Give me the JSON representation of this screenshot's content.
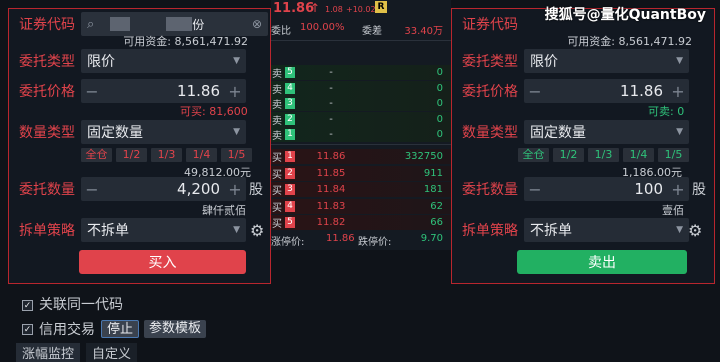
{
  "watermark": "搜狐号@量化QuantBoy",
  "buy_panel": {
    "code_label": "证券代码",
    "code_value": "",
    "name_value": "份",
    "available_funds": "可用资金:  8,561,471.92",
    "order_type_label": "委托类型",
    "order_type_value": "限价",
    "price_label": "委托价格",
    "price_value": "11.86",
    "can_buy": "可买:  81,600",
    "qty_type_label": "数量类型",
    "qty_type_value": "固定数量",
    "fractions": [
      "全仓",
      "1/2",
      "1/3",
      "1/4",
      "1/5"
    ],
    "amount": "49,812.00元",
    "qty_label": "委托数量",
    "qty_value": "4,200",
    "qty_unit": "股",
    "qty_chinese": "肆仟贰佰",
    "split_label": "拆单策略",
    "split_value": "不拆单",
    "submit_label": "买入"
  },
  "sell_panel": {
    "code_label": "证券代码",
    "available_funds": "可用资金:  8,561,471.92",
    "order_type_label": "委托类型",
    "order_type_value": "限价",
    "price_label": "委托价格",
    "price_value": "11.86",
    "can_sell": "可卖:  0",
    "qty_type_label": "数量类型",
    "qty_type_value": "固定数量",
    "fractions": [
      "全仓",
      "1/2",
      "1/3",
      "1/4",
      "1/5"
    ],
    "amount": "1,186.00元",
    "qty_label": "委托数量",
    "qty_value": "100",
    "qty_unit": "股",
    "qty_chinese": "壹佰",
    "split_label": "拆单策略",
    "split_value": "不拆单",
    "submit_label": "卖出"
  },
  "quote": {
    "price": "11.86",
    "change": "1.08",
    "change_pct": "+10.02%",
    "badge": "R",
    "ratio_label": "委比",
    "ratio_value": "100.00%",
    "diff_label": "委差",
    "diff_value": "33.40万",
    "sells": [
      {
        "side": "卖",
        "level": "5",
        "price": "-",
        "vol": "0"
      },
      {
        "side": "卖",
        "level": "4",
        "price": "-",
        "vol": "0"
      },
      {
        "side": "卖",
        "level": "3",
        "price": "-",
        "vol": "0"
      },
      {
        "side": "卖",
        "level": "2",
        "price": "-",
        "vol": "0"
      },
      {
        "side": "卖",
        "level": "1",
        "price": "-",
        "vol": "0"
      }
    ],
    "buys": [
      {
        "side": "买",
        "level": "1",
        "price": "11.86",
        "vol": "332750"
      },
      {
        "side": "买",
        "level": "2",
        "price": "11.85",
        "vol": "911"
      },
      {
        "side": "买",
        "level": "3",
        "price": "11.84",
        "vol": "181"
      },
      {
        "side": "买",
        "level": "4",
        "price": "11.83",
        "vol": "62"
      },
      {
        "side": "买",
        "level": "5",
        "price": "11.82",
        "vol": "66"
      }
    ],
    "limit_up_label": "涨停价:",
    "limit_up_value": "11.86",
    "limit_down_label": "跌停价:",
    "limit_down_value": "9.70"
  },
  "bottom": {
    "link_code_label": "关联同一代码",
    "credit_label": "信用交易",
    "stop_label": "停止",
    "template_label": "参数模板",
    "tab1": "涨幅监控",
    "tab2": "自定义"
  },
  "colors": {
    "buy": "#e0434b",
    "sell": "#2fc27a"
  }
}
